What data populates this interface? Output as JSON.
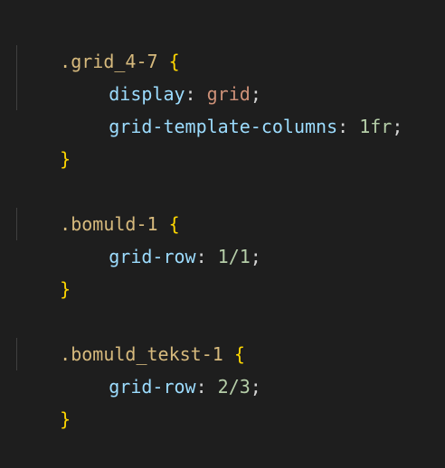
{
  "rules": [
    {
      "selector": ".grid_4-7",
      "open": "{",
      "close": "}",
      "declarations": [
        {
          "property": "display",
          "colon": ":",
          "value": "grid",
          "semi": ";"
        },
        {
          "property": "grid-template-columns",
          "colon": ":",
          "value": "1fr",
          "semi": ";"
        }
      ]
    },
    {
      "selector": ".bomuld-1",
      "open": "{",
      "close": "}",
      "declarations": [
        {
          "property": "grid-row",
          "colon": ":",
          "value": "1/1",
          "semi": ";"
        }
      ]
    },
    {
      "selector": ".bomuld_tekst-1",
      "open": "{",
      "close": "}",
      "declarations": [
        {
          "property": "grid-row",
          "colon": ":",
          "value": "2/3",
          "semi": ";"
        }
      ]
    }
  ],
  "colors": {
    "background": "#1e1e1e",
    "selector": "#d7ba7d",
    "brace": "#ffd700",
    "property": "#9cdcfe",
    "keyword_value": "#ce9178",
    "numeric_value": "#b5cea8",
    "punctuation": "#d4d4d4"
  }
}
